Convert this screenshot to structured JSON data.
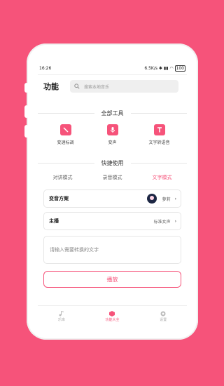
{
  "statusbar": {
    "time": "16:26",
    "net": "6.5K/s",
    "battery": "100"
  },
  "header": {
    "title": "功能",
    "search_placeholder": "搜索本地音乐"
  },
  "sections": {
    "all_tools": "全部工具",
    "quick_use": "快捷使用"
  },
  "tools": [
    {
      "label": "变速标调",
      "icon": "magic-wand-icon"
    },
    {
      "label": "变声",
      "icon": "microphone-icon"
    },
    {
      "label": "文字转语音",
      "icon": "text-icon"
    }
  ],
  "modes": {
    "walkie": "对讲模式",
    "recording": "录音模式",
    "text": "文字模式"
  },
  "settings": {
    "voice_scheme_label": "变音方案",
    "voice_scheme_value": "萝莉",
    "anchor_label": "主播",
    "anchor_value": "标准女声"
  },
  "input": {
    "placeholder": "请输入需要转换的文字"
  },
  "play_label": "播放",
  "tabbar": {
    "library": "乐库",
    "features": "功能大全",
    "settings": "设置"
  },
  "colors": {
    "accent": "#f6537a"
  }
}
